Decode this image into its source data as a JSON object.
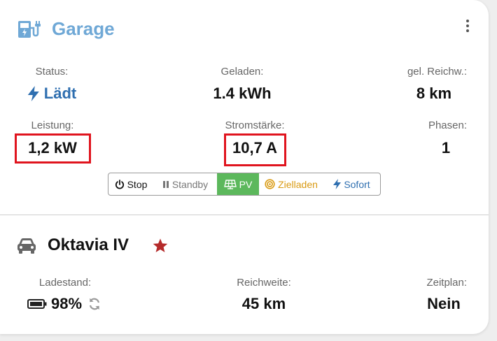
{
  "header": {
    "title": "Garage",
    "icon": "ev-charger-icon",
    "menu_icon": "more-vertical-icon"
  },
  "loadpoint": {
    "status": {
      "label": "Status:",
      "value": "Lädt",
      "icon": "bolt-icon"
    },
    "charged": {
      "label": "Geladen:",
      "value": "1.4 kWh"
    },
    "range_added": {
      "label": "gel. Reichw.:",
      "value": "8 km"
    },
    "power": {
      "label": "Leistung:",
      "value": "1,2 kW"
    },
    "current": {
      "label": "Stromstärke:",
      "value": "10,7 A"
    },
    "phases": {
      "label": "Phasen:",
      "value": "1"
    }
  },
  "modes": {
    "selected": "PV",
    "items": [
      {
        "label": "Stop",
        "icon": "power-icon"
      },
      {
        "label": "Standby",
        "icon": "pause-icon"
      },
      {
        "label": "PV",
        "icon": "solar-panel-icon"
      },
      {
        "label": "Zielladen",
        "icon": "target-icon"
      },
      {
        "label": "Sofort",
        "icon": "bolt-icon"
      }
    ]
  },
  "vehicle": {
    "name": "Oktavia IV",
    "icon": "car-icon",
    "favorite_icon": "star-icon",
    "soc": {
      "label": "Ladestand:",
      "value": "98%",
      "icon": "battery-icon",
      "refresh_icon": "refresh-icon"
    },
    "range": {
      "label": "Reichweite:",
      "value": "45 km"
    },
    "plan": {
      "label": "Zeitplan:",
      "value": "Nein"
    }
  },
  "colors": {
    "accent": "#2f6fb0",
    "title": "#6fa8d6",
    "pv_active": "#5cb85c",
    "target": "#d99a12",
    "favorite": "#b52b2b",
    "highlight": "#e0141e"
  }
}
